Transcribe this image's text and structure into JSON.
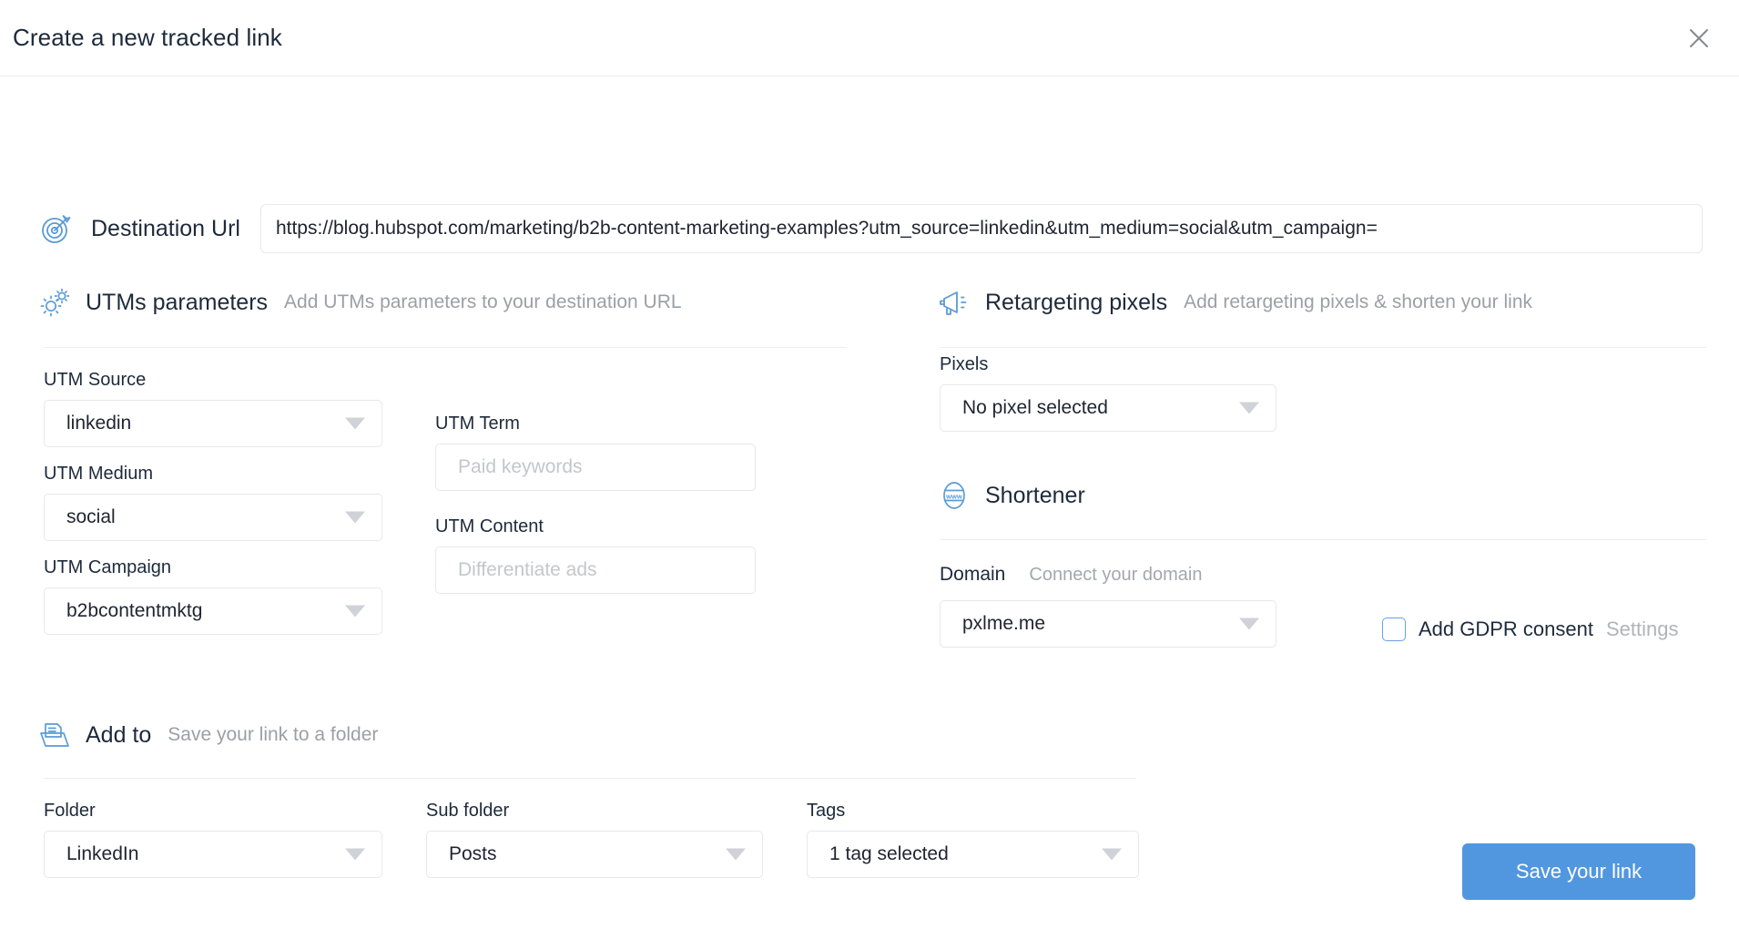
{
  "header": {
    "title": "Create a new tracked link",
    "close_icon": "close-icon"
  },
  "destination": {
    "icon": "target-icon",
    "label": "Destination Url",
    "value": "https://blog.hubspot.com/marketing/b2b-content-marketing-examples?utm_source=linkedin&utm_medium=social&utm_campaign="
  },
  "utms": {
    "icon": "gears-icon",
    "title": "UTMs parameters",
    "subtitle": "Add UTMs parameters to your destination URL",
    "source": {
      "label": "UTM Source",
      "value": "linkedin"
    },
    "medium": {
      "label": "UTM Medium",
      "value": "social"
    },
    "campaign": {
      "label": "UTM Campaign",
      "value": "b2bcontentmktg"
    },
    "term": {
      "label": "UTM Term",
      "placeholder": "Paid keywords",
      "value": ""
    },
    "content": {
      "label": "UTM Content",
      "placeholder": "Differentiate ads",
      "value": ""
    }
  },
  "retargeting": {
    "icon": "megaphone-icon",
    "title": "Retargeting pixels",
    "subtitle": "Add retargeting pixels & shorten your link",
    "pixels": {
      "label": "Pixels",
      "value": "No pixel selected"
    }
  },
  "shortener": {
    "icon": "www-globe-icon",
    "title": "Shortener",
    "domain": {
      "label": "Domain",
      "connect_link": "Connect your domain",
      "value": "pxlme.me"
    },
    "gdpr": {
      "label": "Add GDPR consent",
      "settings": "Settings",
      "checked": false
    }
  },
  "add_to": {
    "icon": "folder-icon",
    "title": "Add to",
    "subtitle": "Save your link to a folder",
    "folder": {
      "label": "Folder",
      "value": "LinkedIn"
    },
    "sub_folder": {
      "label": "Sub folder",
      "value": "Posts"
    },
    "tags": {
      "label": "Tags",
      "value": "1 tag selected"
    }
  },
  "footer": {
    "save_label": "Save your link"
  },
  "colors": {
    "accent": "#5197e0",
    "icon_blue": "#5b9bd5",
    "title": "#1d2a3b",
    "muted": "#9aa0a6"
  }
}
